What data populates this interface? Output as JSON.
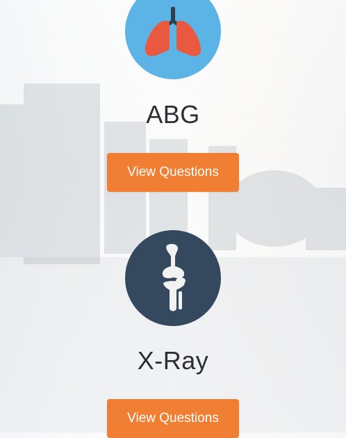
{
  "cards": [
    {
      "title": "ABG",
      "icon": "lungs-icon",
      "icon_bg": "#5cb4e6",
      "button_label": "View Questions"
    },
    {
      "title": "X-Ray",
      "icon": "knee-joint-icon",
      "icon_bg": "#34495e",
      "button_label": "View Questions"
    }
  ],
  "colors": {
    "button": "#f07f34",
    "title": "#2b2f33"
  }
}
